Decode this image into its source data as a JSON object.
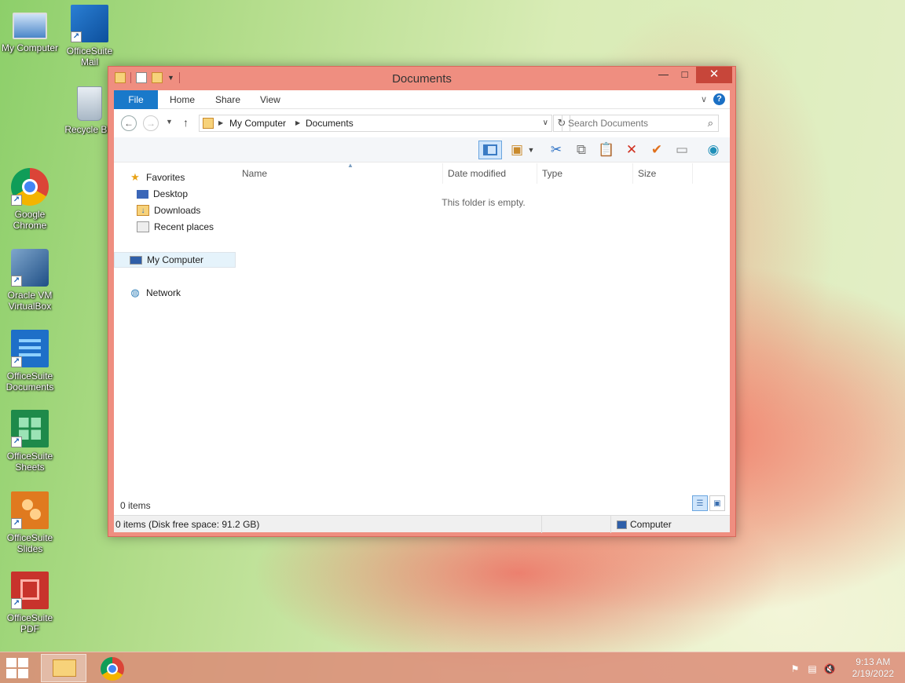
{
  "desktop": {
    "icons": [
      {
        "label": "My Computer",
        "icon": "computer-icon"
      },
      {
        "label": "OfficeSuite Mail",
        "icon": "mail-icon"
      },
      {
        "label": "Recycle Bin",
        "icon": "recycle-bin-icon"
      },
      {
        "label": "Google Chrome",
        "icon": "chrome-icon"
      },
      {
        "label": "Oracle VM VirtualBox",
        "icon": "virtualbox-icon"
      },
      {
        "label": "OfficeSuite Documents",
        "icon": "documents-icon"
      },
      {
        "label": "OfficeSuite Sheets",
        "icon": "sheets-icon"
      },
      {
        "label": "OfficeSuite Slides",
        "icon": "slides-icon"
      },
      {
        "label": "OfficeSuite PDF",
        "icon": "pdf-icon"
      }
    ]
  },
  "window": {
    "title": "Documents",
    "controls": {
      "minimize": "—",
      "maximize": "□",
      "close": "✕"
    },
    "ribbon_tabs": [
      "File",
      "Home",
      "Share",
      "View"
    ],
    "help": "?",
    "address": {
      "crumbs": [
        "My Computer",
        "Documents"
      ]
    },
    "search": {
      "placeholder": "Search Documents"
    },
    "nav_pane": {
      "favorites": "Favorites",
      "favorite_items": [
        "Desktop",
        "Downloads",
        "Recent places"
      ],
      "computer": "My Computer",
      "network": "Network"
    },
    "columns": [
      "Name",
      "Date modified",
      "Type",
      "Size"
    ],
    "empty_message": "This folder is empty.",
    "item_count": "0 items",
    "status": {
      "left": "0 items (Disk free space: 91.2 GB)",
      "right": "Computer"
    }
  },
  "taskbar": {
    "time": "9:13 AM",
    "date": "2/19/2022"
  },
  "colors": {
    "window_frame": "#ef8e80",
    "file_tab": "#1979ca",
    "close_button": "#c7463a"
  }
}
